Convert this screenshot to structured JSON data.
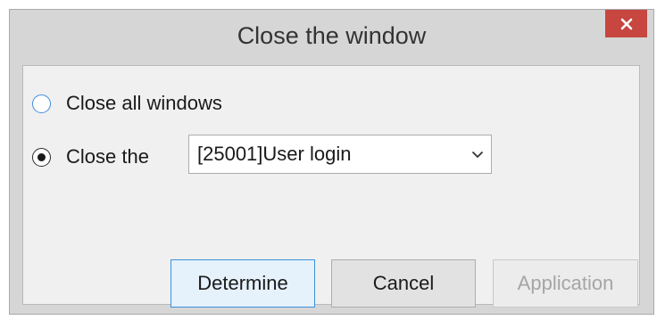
{
  "dialog": {
    "title": "Close the window"
  },
  "options": {
    "close_all_label": "Close all windows",
    "close_the_label": "Close the",
    "selected_option": "close_the"
  },
  "window_select": {
    "value": "[25001]User login"
  },
  "buttons": {
    "determine": "Determine",
    "cancel": "Cancel",
    "application": "Application"
  },
  "icons": {
    "close": "close-icon",
    "dropdown": "chevron-down-icon"
  },
  "colors": {
    "close_button": "#c7463f",
    "focus_accent": "#3c8fdb"
  }
}
